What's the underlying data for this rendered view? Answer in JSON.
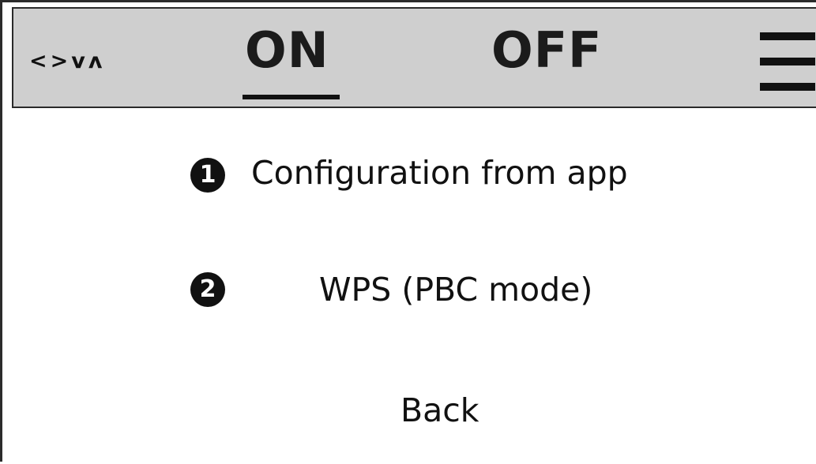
{
  "header": {
    "nav_symbols": [
      "<",
      ">",
      "v",
      "ʌ"
    ],
    "tabs": [
      {
        "label": "ON",
        "selected": true
      },
      {
        "label": "OFF",
        "selected": false
      }
    ],
    "menu_icon": "hamburger-menu-icon"
  },
  "menu": {
    "options": [
      {
        "number": "1",
        "label": "Configuration from app"
      },
      {
        "number": "2",
        "label": "WPS (PBC mode)"
      }
    ],
    "back_label": "Back"
  }
}
